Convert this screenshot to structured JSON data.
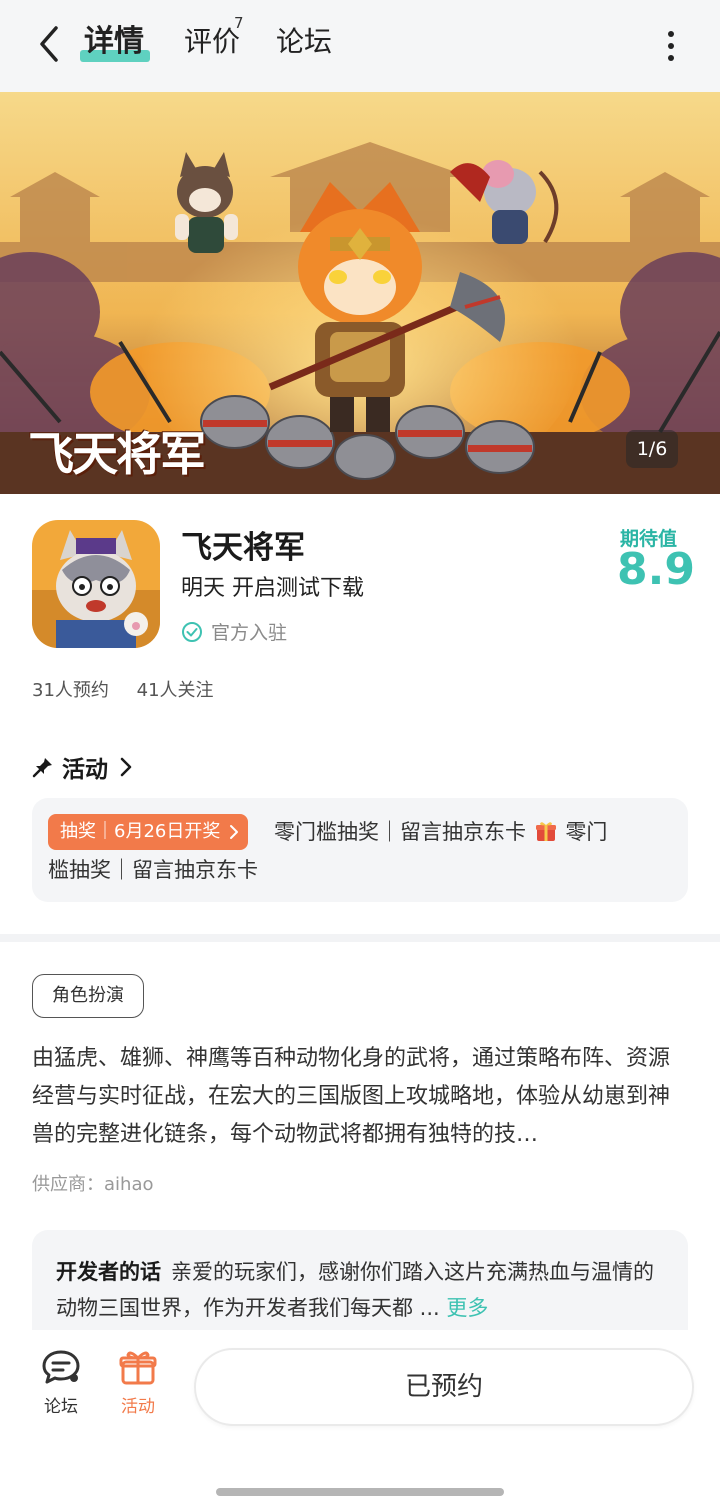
{
  "nav": {
    "tabs": [
      {
        "label": "详情",
        "active": true
      },
      {
        "label": "评价",
        "badge": "7"
      },
      {
        "label": "论坛"
      }
    ],
    "back_icon": "chevron-left-icon",
    "more_icon": "more-vertical-icon"
  },
  "banner": {
    "logo_text": "飞天将军",
    "counter": "1/6"
  },
  "game": {
    "title": "飞天将军",
    "subtitle": "明天 开启测试下载",
    "official": "官方入驻",
    "expect_label": "期待值",
    "expect_value": "8.9"
  },
  "stats": {
    "reservations": "31人预约",
    "followers": "41人关注"
  },
  "activity": {
    "heading": "活动",
    "tag": "抽奖｜6月26日开奖",
    "line1_text": "零门槛抽奖｜留言抽京东卡",
    "line1_tail": "零门",
    "line2": "槛抽奖｜留言抽京东卡"
  },
  "genre": "角色扮演",
  "description": "由猛虎、雄狮、神鹰等百种动物化身的武将，通过策略布阵、资源经营与实时征战，在宏大的三国版图上攻城略地，体验从幼崽到神兽的完整进化链条，每个动物武将都拥有独特的技…",
  "supplier": "供应商：aihao",
  "developer": {
    "label": "开发者的话",
    "text": "亲爱的玩家们，感谢你们踏入这片充满热血与温情的动物三国世界，作为开发者我们每天都 ...",
    "more": "更多"
  },
  "bottom": {
    "forum_label": "论坛",
    "activity_label": "活动",
    "reserve_label": "已预约"
  },
  "colors": {
    "accent": "#3ec2b2",
    "orange": "#f27a4a"
  }
}
